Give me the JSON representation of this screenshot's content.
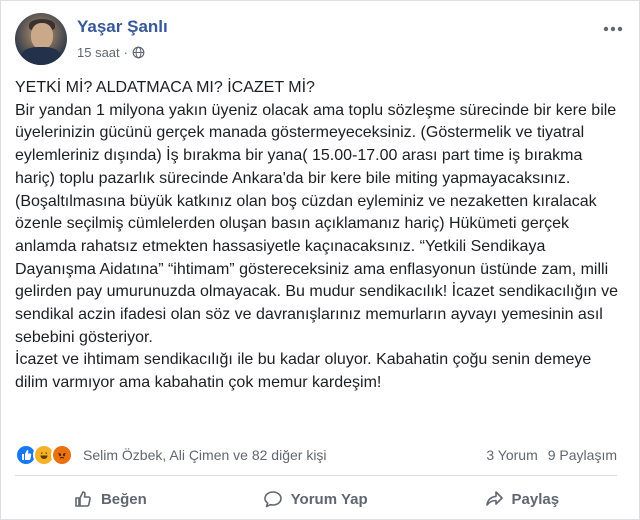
{
  "post": {
    "author": "Yaşar Şanlı",
    "time": "15 saat",
    "separator": "·",
    "privacy_icon": "globe-icon",
    "more_icon": "more-options-icon",
    "text": "YETKİ Mİ? ALDATMACA MI? İCAZET Mİ?\nBir yandan 1 milyona yakın üyeniz olacak ama toplu sözleşme sürecinde bir kere bile üyelerinizin gücünü gerçek manada göstermeyeceksiniz. (Göstermelik ve tiyatral eylemleriniz dışında) İş bırakma bir yana( 15.00-17.00 arası part time iş bırakma hariç) toplu pazarlık sürecinde Ankara'da bir kere bile miting yapmayacaksınız.(Boşaltılmasına büyük katkınız olan boş cüzdan eyleminiz ve nezaketten kıralacak özenle seçilmiş cümlelerden oluşan basın açıklamanız hariç) Hükümeti gerçek anlamda rahatsız etmekten hassasiyetle kaçınacaksınız. “Yetkili Sendikaya Dayanışma Aidatına” “ihtimam” göstereceksiniz ama enflasyonun üstünde zam, milli gelirden pay umurunuzda olmayacak. Bu mudur sendikacılık! İcazet sendikacılığın ve sendikal aczin ifadesi olan söz ve davranışlarınız memurların ayvayı yemesinin asıl sebebini gösteriyor.\nİcazet ve ihtimam sendikacılığı ile bu kadar oluyor. Kabahatin çoğu senin demeye dilim varmıyor ama kabahatin çok memur kardeşim!"
  },
  "reactions": {
    "icons": [
      "like-icon",
      "haha-icon",
      "angry-icon"
    ],
    "reactors": "Selim Özbek, Ali Çimen ve 82 diğer kişi",
    "comments": "3 Yorum",
    "shares": "9 Paylaşım"
  },
  "actions": {
    "like": "Beğen",
    "comment": "Yorum Yap",
    "share": "Paylaş"
  },
  "colors": {
    "author": "#385898",
    "muted": "#606770",
    "like": "#1877f2",
    "haha": "#f7b125",
    "angry": "#e9710f"
  }
}
